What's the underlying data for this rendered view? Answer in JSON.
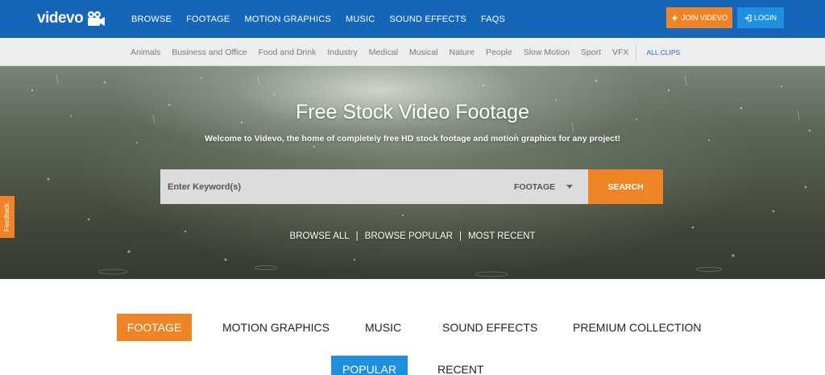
{
  "header": {
    "logo_text": "videvo",
    "nav": [
      "BROWSE",
      "FOOTAGE",
      "MOTION GRAPHICS",
      "MUSIC",
      "SOUND EFFECTS",
      "FAQS"
    ],
    "join_label": "JOIN VIDEVO",
    "login_label": "LOGIN"
  },
  "categories": {
    "items": [
      "Animals",
      "Business and Office",
      "Food and Drink",
      "Industry",
      "Medical",
      "Musical",
      "Nature",
      "People",
      "Slow Motion",
      "Sport",
      "VFX"
    ],
    "all_clips": "ALL CLIPS"
  },
  "hero": {
    "title": "Free Stock Video Footage",
    "subtitle": "Welcome to Videvo, the home of completely free HD stock footage and motion graphics for any project!",
    "search_placeholder": "Enter Keyword(s)",
    "search_type": "FOOTAGE",
    "search_button": "SEARCH",
    "links": [
      "BROWSE ALL",
      "BROWSE POPULAR",
      "MOST RECENT"
    ],
    "link_separator": "|"
  },
  "feedback": {
    "label": "Feedback"
  },
  "content_tabs": {
    "types": [
      "FOOTAGE",
      "MOTION GRAPHICS",
      "MUSIC",
      "SOUND EFFECTS",
      "PREMIUM COLLECTION"
    ],
    "active_type": "FOOTAGE",
    "sorts": [
      "POPULAR",
      "RECENT"
    ],
    "active_sort": "POPULAR"
  },
  "colors": {
    "header_bg": "#1565b8",
    "accent_orange": "#ef8427",
    "accent_blue": "#1f8fe0",
    "category_bar_bg": "#ededed"
  }
}
